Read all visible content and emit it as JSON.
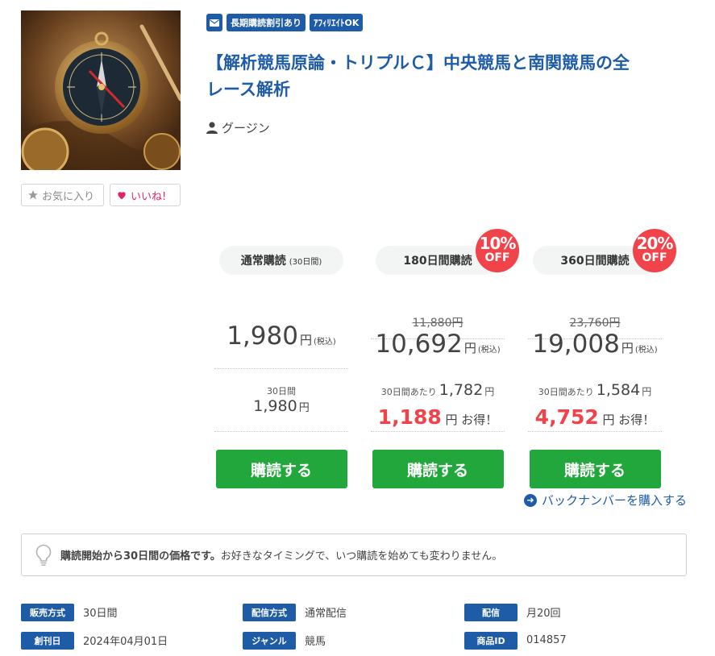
{
  "product": {
    "image_alt": "compass-image",
    "tags": [
      "長期購読割引あり",
      "ｱﾌｨﾘｴｲﾄOK"
    ],
    "title_line1": "【解析競馬原論・トリプルＣ】中央競馬と南関競馬の全",
    "title_line2": "レース解析",
    "author": "グージン",
    "favorite_label": "お気に入り",
    "like_label": "いいね!"
  },
  "plans": [
    {
      "name": "通常購読",
      "period_note": "(30日間)",
      "price": "1,980",
      "yen": "円",
      "tax": "(税込)",
      "detail_label": "30日間",
      "detail_value": "1,980",
      "detail_yen": "円",
      "button": "購読する"
    },
    {
      "name": "180日間購読",
      "discount_pct": "10%",
      "discount_off": "OFF",
      "original_price": "11,880円",
      "price": "10,692",
      "yen": "円",
      "tax": "(税込)",
      "per_label": "30日間あたり",
      "per_value": "1,782",
      "per_yen": "円",
      "savings": "1,188",
      "savings_suffix": "円 お得！",
      "button": "購読する"
    },
    {
      "name": "360日間購読",
      "discount_pct": "20%",
      "discount_off": "OFF",
      "original_price": "23,760円",
      "price": "19,008",
      "yen": "円",
      "tax": "(税込)",
      "per_label": "30日間あたり",
      "per_value": "1,584",
      "per_yen": "円",
      "savings": "4,752",
      "savings_suffix": "円 お得！",
      "button": "購読する"
    }
  ],
  "backnumber_link": "バックナンバーを購入する",
  "notice": {
    "bold": "購読開始から30日間の価格です。",
    "text": "お好きなタイミングで、いつ購読を始めても変わりません。"
  },
  "meta": [
    [
      {
        "label": "販売方式",
        "value": "30日間"
      },
      {
        "label": "配信方式",
        "value": "通常配信"
      },
      {
        "label": "配信",
        "value": "月20回"
      }
    ],
    [
      {
        "label": "創刊日",
        "value": "2024年04月01日"
      },
      {
        "label": "ジャンル",
        "value": "競馬"
      },
      {
        "label": "商品ID",
        "value": "014857"
      }
    ]
  ],
  "colors": {
    "brand_blue": "#1f5ca8",
    "subscribe_green": "#22a73c",
    "discount_red": "#f0434a",
    "like_pink": "#e0246a"
  }
}
